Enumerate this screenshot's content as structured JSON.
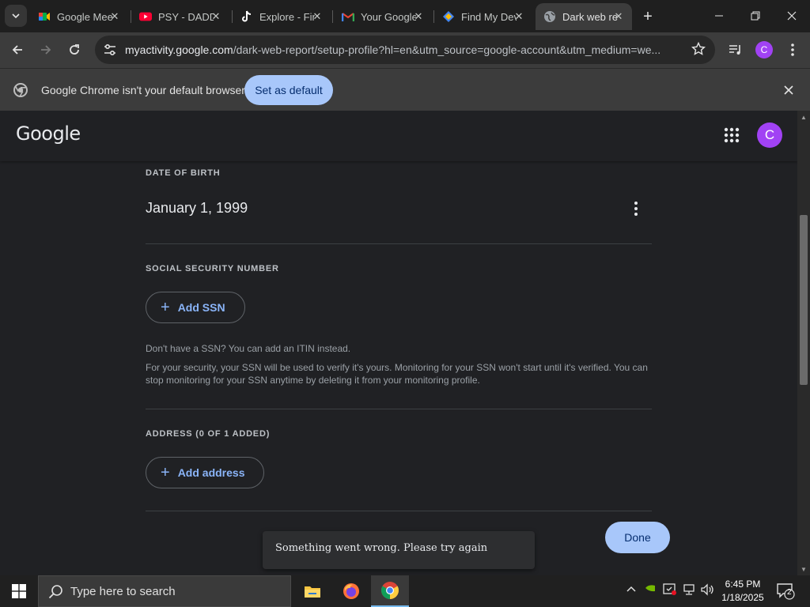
{
  "tabs": [
    {
      "title": "Google Meet",
      "icon": "google-meet-icon",
      "color": "#00897b"
    },
    {
      "title": "PSY - DADDY",
      "icon": "youtube-icon",
      "color": "#ff0033"
    },
    {
      "title": "Explore - Find",
      "icon": "tiktok-icon",
      "color": "#ffffff"
    },
    {
      "title": "Your Google Account",
      "icon": "gmail-icon",
      "color": "#ea4335"
    },
    {
      "title": "Find My Device",
      "icon": "find-my-device-icon",
      "color": "#4285f4"
    },
    {
      "title": "Dark web report",
      "icon": "globe-icon",
      "color": "#9aa0a6"
    }
  ],
  "omnibox": {
    "host": "myactivity.google.com",
    "path": "/dark-web-report/setup-profile?hl=en&utm_source=google-account&utm_medium=we..."
  },
  "profile_initial": "C",
  "infobar": {
    "message": "Google Chrome isn't your default browser",
    "button": "Set as default"
  },
  "page": {
    "logo": "Google",
    "dob": {
      "label": "DATE OF BIRTH",
      "value": "January 1, 1999"
    },
    "ssn": {
      "label": "SOCIAL SECURITY NUMBER",
      "button": "Add SSN",
      "note1": "Don't have a SSN? You can add an ITIN instead.",
      "note2": "For your security, your SSN will be used to verify it's yours. Monitoring for your SSN won't start until it's verified. You can stop monitoring for your SSN anytime by deleting it from your monitoring profile."
    },
    "address": {
      "label": "ADDRESS (0 OF 1 ADDED)",
      "button": "Add address"
    },
    "done": "Done",
    "toast": "Something went wrong. Please try again"
  },
  "taskbar": {
    "search_placeholder": "Type here to search",
    "time": "6:45 PM",
    "date": "1/18/2025",
    "notification_count": "2"
  },
  "colors": {
    "accent": "#a8c7fa",
    "link": "#8ab4f8",
    "avatar": "#a142f4"
  }
}
